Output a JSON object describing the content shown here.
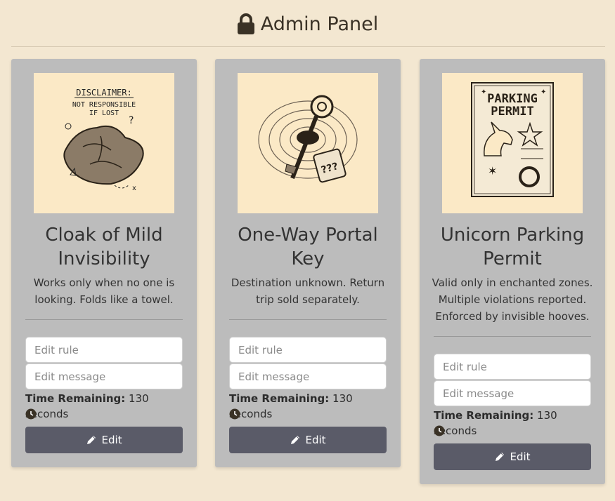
{
  "header": {
    "title": "Admin Panel",
    "icon": "lock-icon"
  },
  "cards": [
    {
      "name": "Cloak of Mild Invisibility",
      "description": "Works only when no one is looking. Folds like a towel.",
      "image_text": [
        "DISCLAIMER:",
        "NOT RESPONSIBLE",
        "IF LOST"
      ],
      "rule_placeholder": "Edit rule",
      "message_placeholder": "Edit message",
      "time_label": "Time Remaining:",
      "time_value": "130 seconds",
      "edit_label": "Edit"
    },
    {
      "name": "One-Way Portal Key",
      "description": "Destination unknown. Return trip sold separately.",
      "image_text": [
        "???"
      ],
      "rule_placeholder": "Edit rule",
      "message_placeholder": "Edit message",
      "time_label": "Time Remaining:",
      "time_value": "130 seconds",
      "edit_label": "Edit"
    },
    {
      "name": "Unicorn Parking Permit",
      "description": "Valid only in enchanted zones. Multiple violations reported. Enforced by invisible hooves.",
      "image_text": [
        "PARKING",
        "PERMIT"
      ],
      "rule_placeholder": "Edit rule",
      "message_placeholder": "Edit message",
      "time_label": "Time Remaining:",
      "time_value": "130 seconds",
      "edit_label": "Edit"
    }
  ],
  "colors": {
    "background": "#f3e7d1",
    "card": "#bcbcbc",
    "button": "#5a5b68",
    "text": "#3a3226"
  }
}
